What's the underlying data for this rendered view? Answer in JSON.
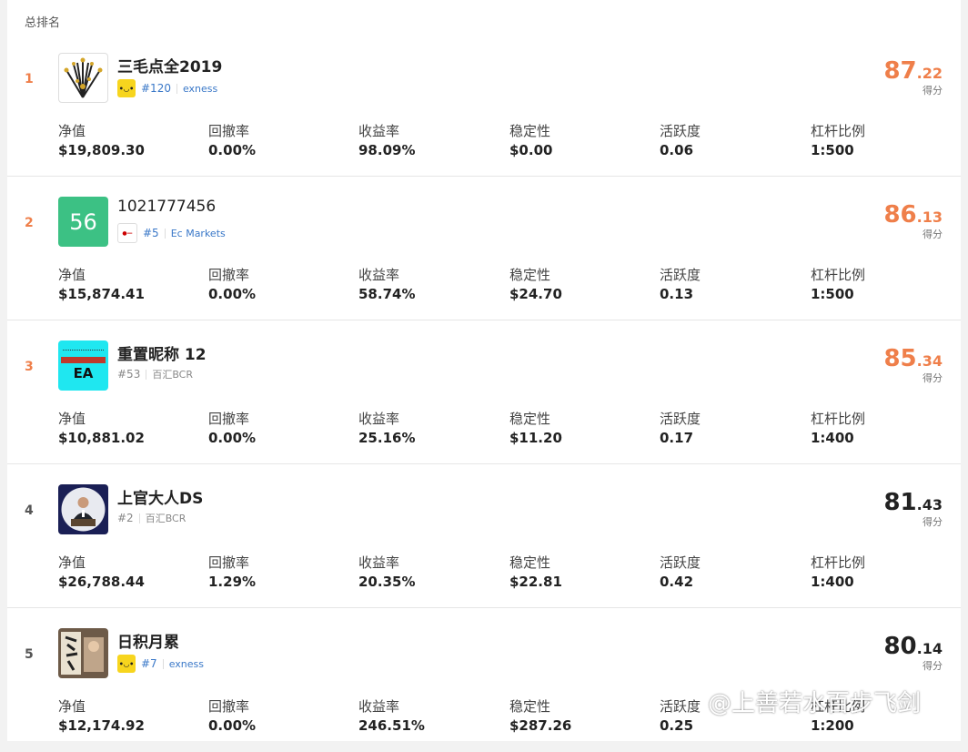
{
  "section_title": "总排名",
  "stat_labels": [
    "净值",
    "回撤率",
    "收益率",
    "稳定性",
    "活跃度",
    "杠杆比例"
  ],
  "score_label": "得分",
  "accent": "#ef7f4a",
  "link_color": "#3a78c8",
  "entries": [
    {
      "rank": "1",
      "name": "三毛点全2019",
      "avatar": "fireworks-avatar",
      "badge": "yellow-broker-badge",
      "broker_rank": "#120",
      "broker": "exness",
      "score_int": "87",
      "score_dec": ".22",
      "values": [
        "$19,809.30",
        "0.00%",
        "98.09%",
        "$0.00",
        "0.06",
        "1:500"
      ]
    },
    {
      "rank": "2",
      "name": "1021777456",
      "avatar_text": "56",
      "badge": "ec-broker-badge",
      "broker_rank": "#5",
      "broker": "Ec Markets",
      "score_int": "86",
      "score_dec": ".13",
      "values": [
        "$15,874.41",
        "0.00%",
        "58.74%",
        "$24.70",
        "0.13",
        "1:500"
      ]
    },
    {
      "rank": "3",
      "name": "重置昵称 12",
      "avatar_text": "EA",
      "broker_rank": "#53",
      "broker": "百汇BCR",
      "score_int": "85",
      "score_dec": ".34",
      "values": [
        "$10,881.02",
        "0.00%",
        "25.16%",
        "$11.20",
        "0.17",
        "1:400"
      ]
    },
    {
      "rank": "4",
      "name": "上官大人DS",
      "avatar": "portrait-avatar",
      "broker_rank": "#2",
      "broker": "百汇BCR",
      "score_int": "81",
      "score_dec": ".43",
      "values": [
        "$26,788.44",
        "1.29%",
        "20.35%",
        "$22.81",
        "0.42",
        "1:400"
      ]
    },
    {
      "rank": "5",
      "name": "日积月累",
      "avatar": "calligraphy-avatar",
      "badge": "yellow-broker-badge",
      "broker_rank": "#7",
      "broker": "exness",
      "score_int": "80",
      "score_dec": ".14",
      "values": [
        "$12,174.92",
        "0.00%",
        "246.51%",
        "$287.26",
        "0.25",
        "1:200"
      ]
    }
  ],
  "watermark": "@上善若水百步飞剑"
}
